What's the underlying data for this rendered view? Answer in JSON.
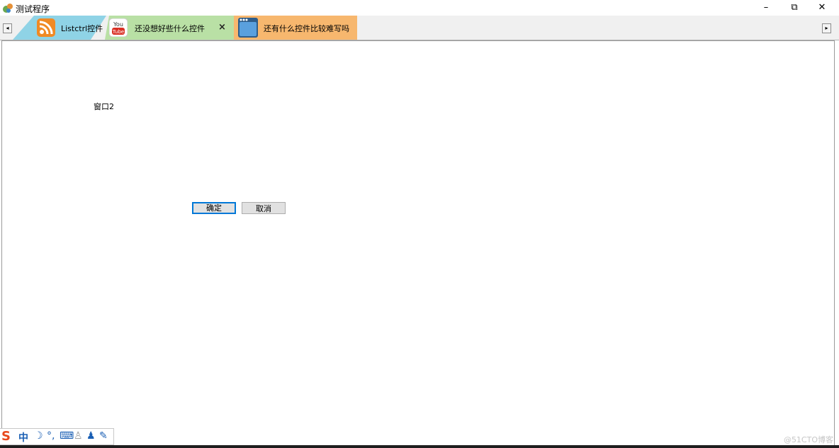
{
  "window": {
    "title": "测试程序",
    "minimize_glyph": "–",
    "restore_glyph": "⧉",
    "close_glyph": "✕"
  },
  "tabbar": {
    "scroll_left_glyph": "◂",
    "scroll_right_glyph": "▸",
    "tabs": [
      {
        "label": "Listctrl控件",
        "icon": "rss-icon",
        "color": "#8fd3e6"
      },
      {
        "label": "还没想好些什么控件",
        "icon": "youtube-icon",
        "color": "#b9e0a5",
        "close_glyph": "×"
      },
      {
        "label": "还有什么控件比较难写吗",
        "icon": "app-window-icon",
        "color": "#f7b76e"
      }
    ]
  },
  "content": {
    "label": "窗口2",
    "ok_label": "确定",
    "cancel_label": "取消"
  },
  "ime_toolbar": {
    "logo": "S",
    "mode": "中",
    "icons": [
      "moon-icon",
      "punctuation-icon",
      "keyboard-icon",
      "user-icon",
      "shirt-icon",
      "wrench-icon"
    ]
  },
  "watermark": "@51CTO博客"
}
